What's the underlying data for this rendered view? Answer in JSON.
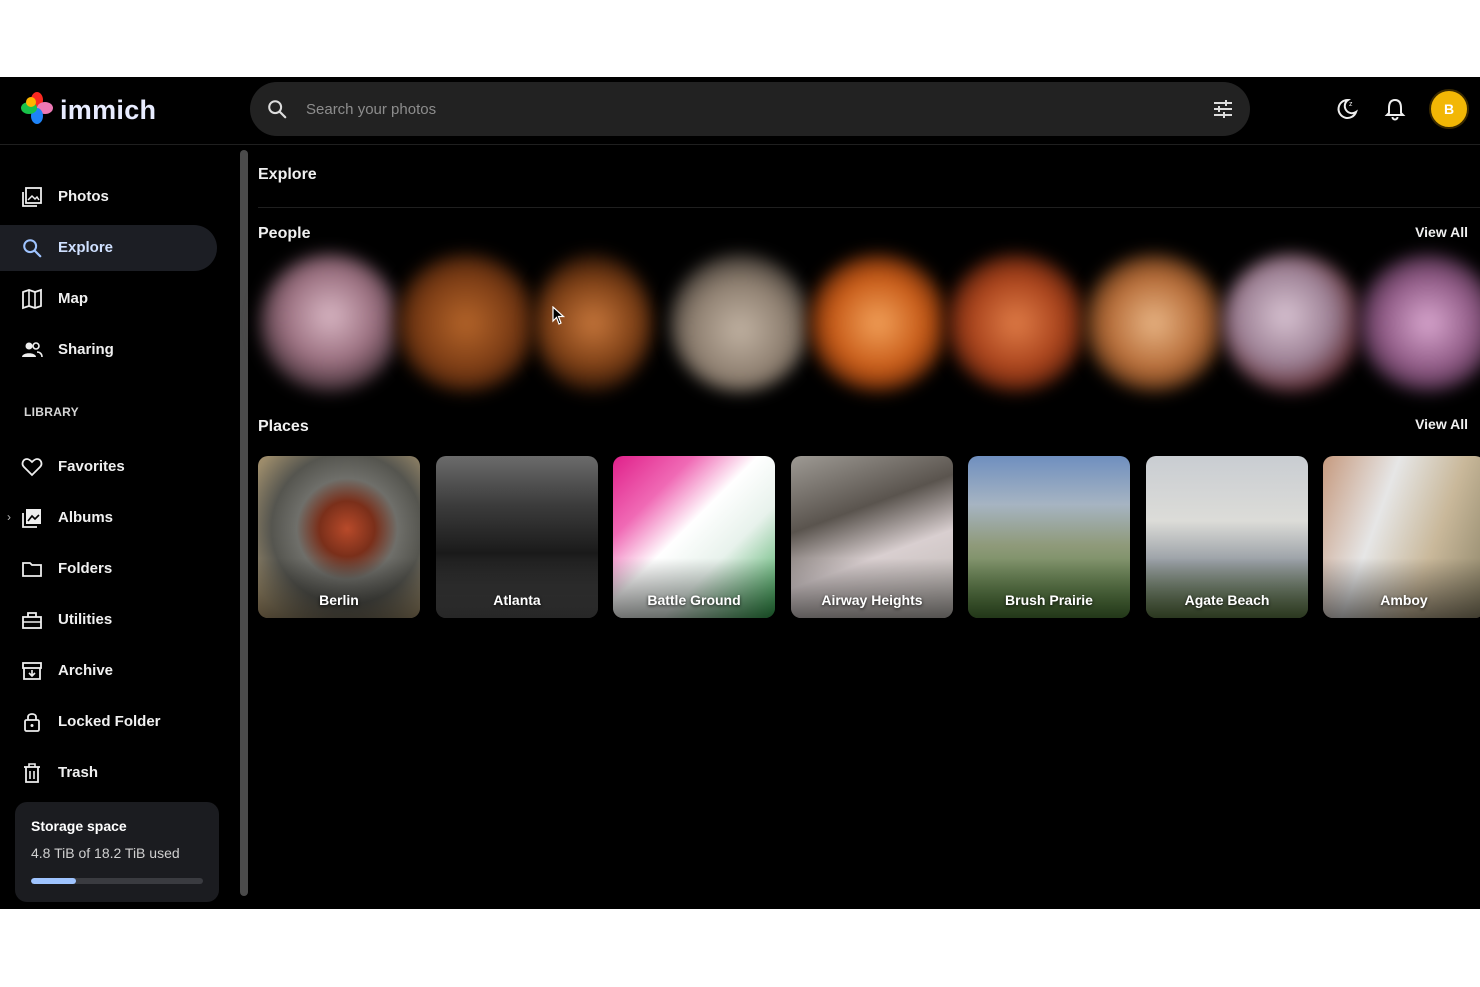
{
  "app": {
    "name": "immich",
    "logo_icon": "immich-pinwheel-icon"
  },
  "search": {
    "placeholder": "Search your photos"
  },
  "header": {
    "icons": [
      "search-icon",
      "tune-icon",
      "theme-toggle-icon",
      "notification-bell-icon"
    ],
    "avatar_initial": "B",
    "avatar_color": "#f2b705"
  },
  "sidebar": {
    "items": [
      {
        "label": "Photos",
        "icon": "photos-icon"
      },
      {
        "label": "Explore",
        "icon": "search-icon",
        "active": true
      },
      {
        "label": "Map",
        "icon": "map-icon"
      },
      {
        "label": "Sharing",
        "icon": "sharing-icon"
      }
    ],
    "library_heading": "LIBRARY",
    "library_items": [
      {
        "label": "Favorites",
        "icon": "heart-icon"
      },
      {
        "label": "Albums",
        "icon": "albums-icon",
        "expandable": true
      },
      {
        "label": "Folders",
        "icon": "folder-icon"
      },
      {
        "label": "Utilities",
        "icon": "toolbox-icon"
      },
      {
        "label": "Archive",
        "icon": "archive-icon"
      },
      {
        "label": "Locked Folder",
        "icon": "lock-icon"
      },
      {
        "label": "Trash",
        "icon": "trash-icon"
      }
    ],
    "storage": {
      "title": "Storage space",
      "used_text": "4.8 TiB of 18.2 TiB used",
      "used_fraction": 0.264
    }
  },
  "main": {
    "title": "Explore",
    "people": {
      "title": "People",
      "view_all": "View All",
      "count": 9
    },
    "places": {
      "title": "Places",
      "view_all": "View All",
      "items": [
        "Berlin",
        "Atlanta",
        "Battle Ground",
        "Airway Heights",
        "Brush Prairie",
        "Agate Beach",
        "Amboy"
      ]
    }
  },
  "colors": {
    "background": "#000000",
    "accent": "#9fc4ff",
    "active_nav": "#1c1e24"
  }
}
